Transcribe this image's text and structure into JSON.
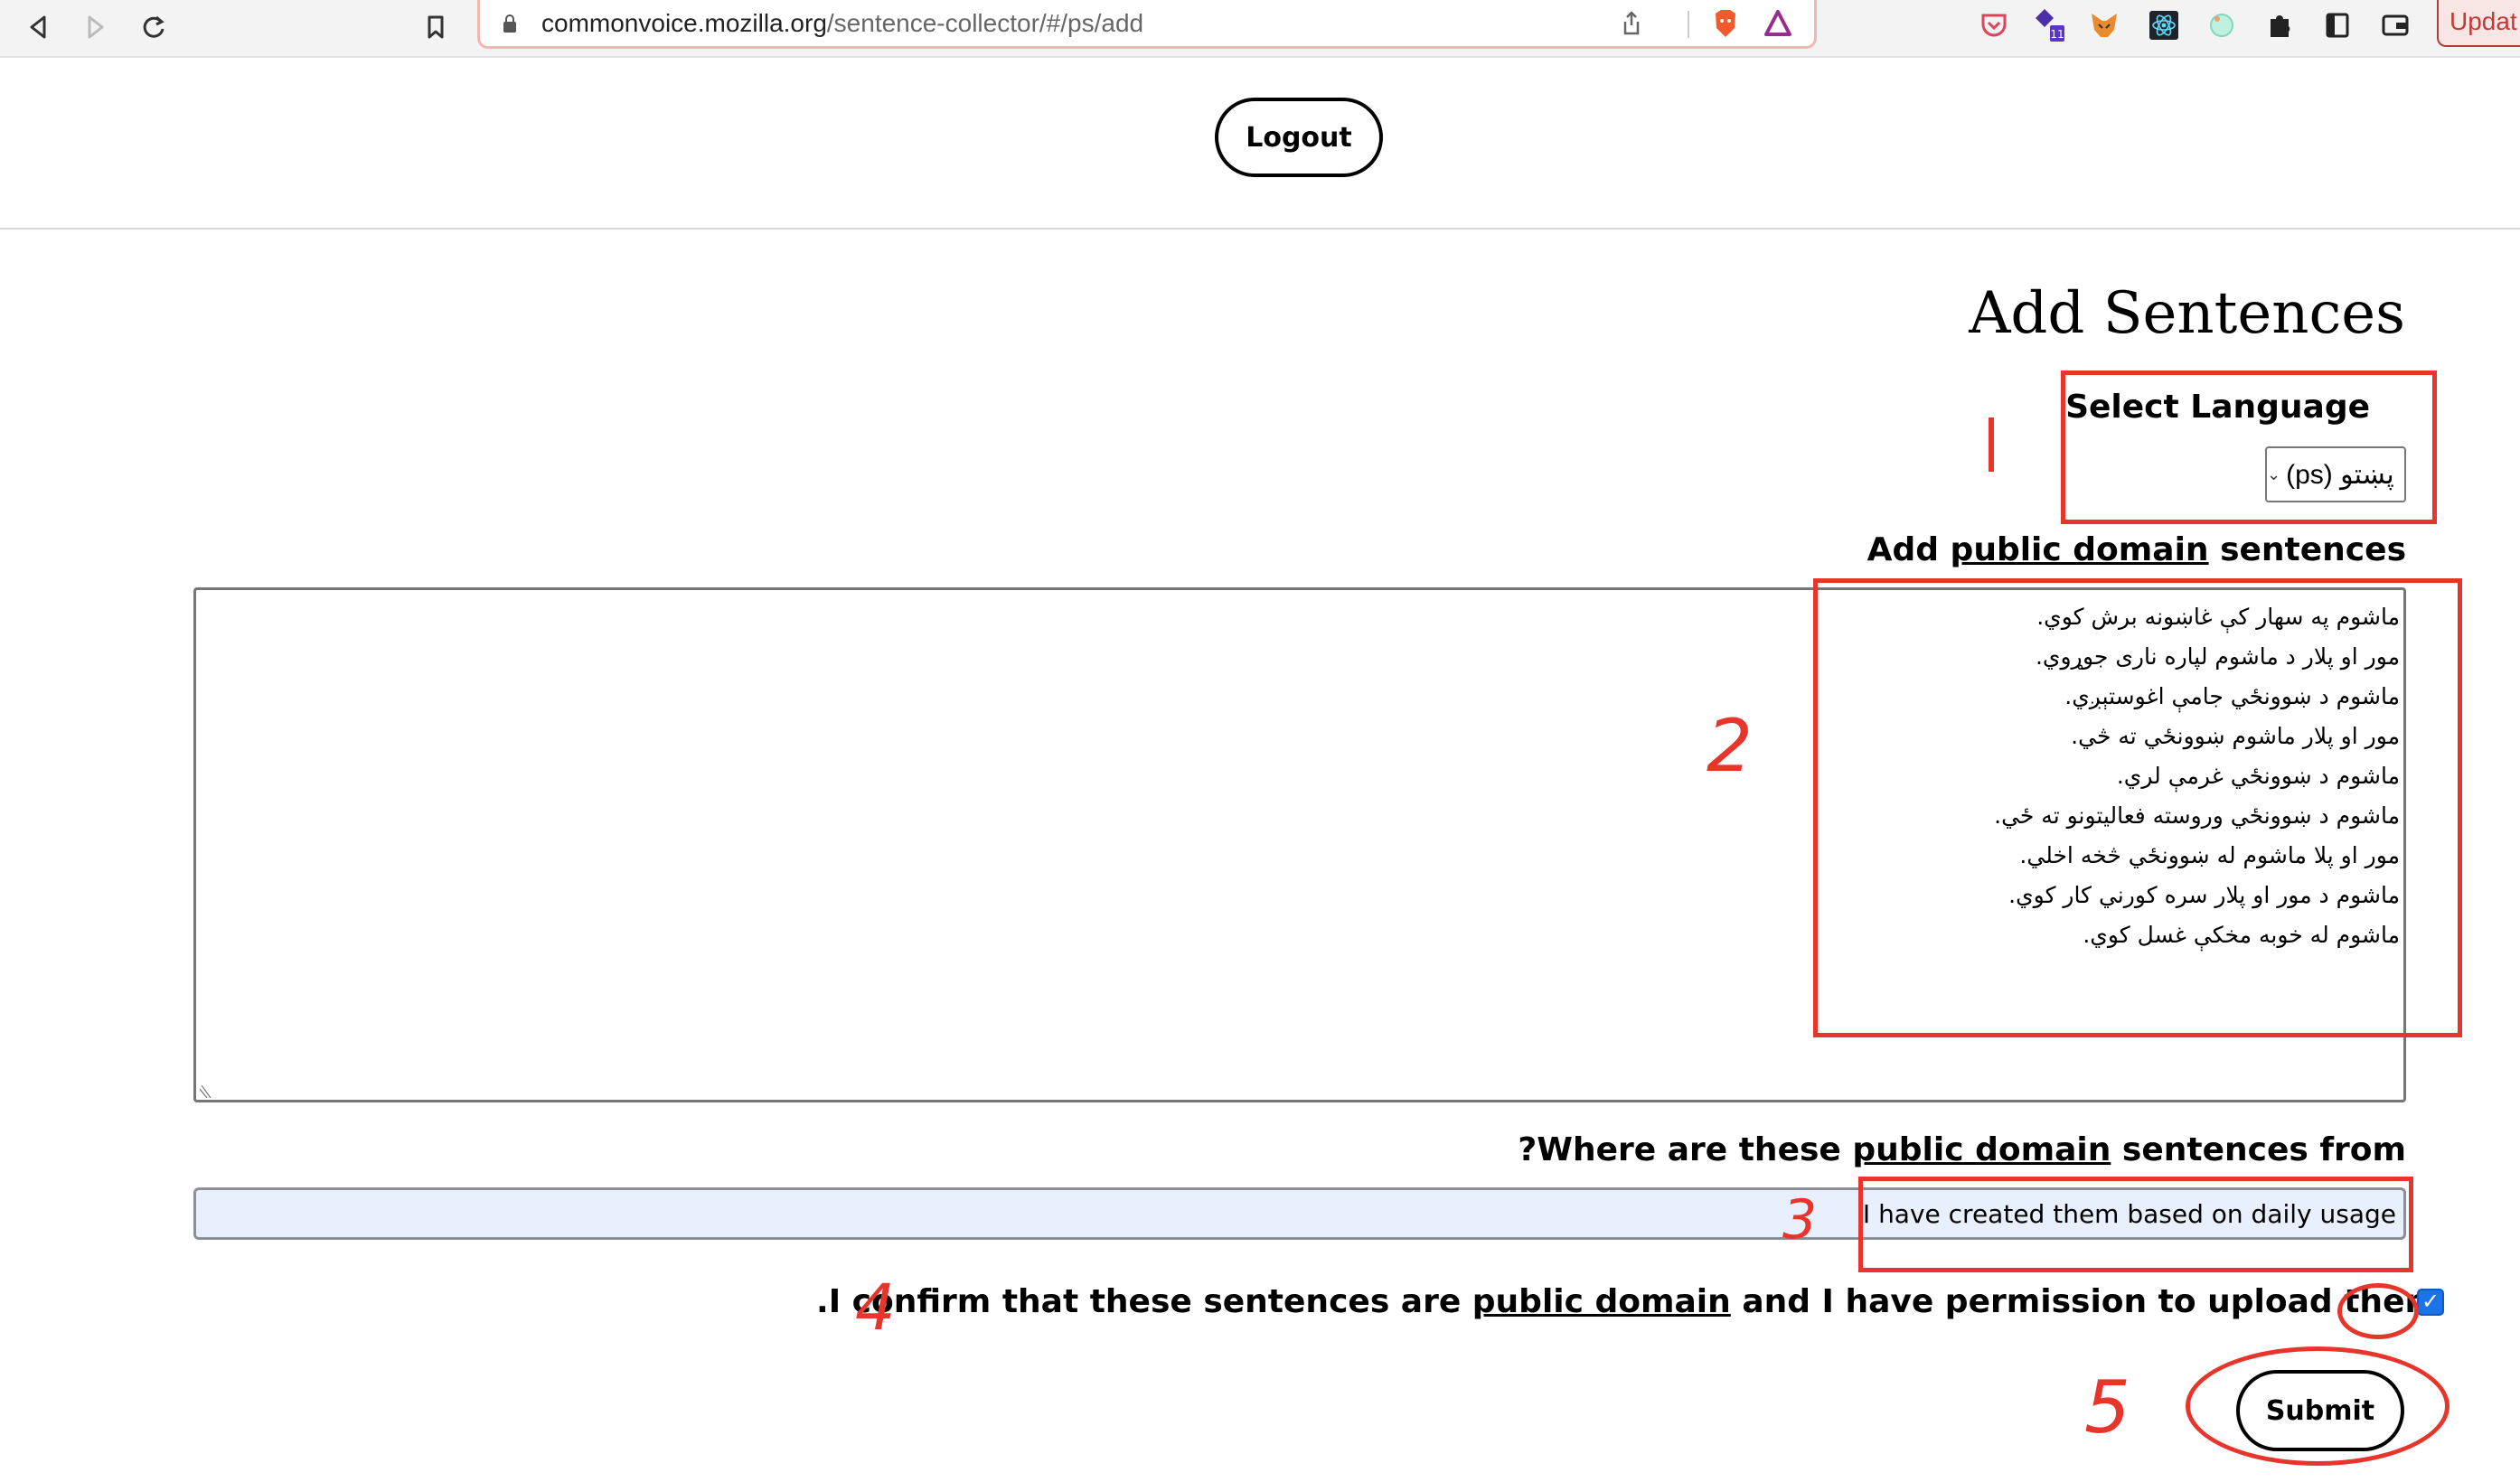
{
  "browser": {
    "url_host": "commonvoice.mozilla.org",
    "url_path": "/sentence-collector/#/ps/add",
    "update_label": "Updat",
    "extension_badge": "11",
    "icons": {
      "back": "back-arrow-icon",
      "forward": "forward-arrow-icon",
      "reload": "reload-icon",
      "bookmark": "bookmark-icon",
      "share": "share-icon",
      "brave": "brave-lion-icon",
      "rewards": "brave-rewards-icon",
      "pocket": "pocket-icon",
      "extensions": [
        "stack-extension-icon",
        "metamask-icon",
        "react-devtools-icon",
        "circle-extension-icon",
        "puzzle-extensions-icon",
        "sidebar-icon",
        "wallet-icon"
      ]
    }
  },
  "header": {
    "logout_label": "Logout"
  },
  "main": {
    "title": "Add Sentences",
    "language": {
      "label": "Select Language",
      "selected": "پښتو (ps)"
    },
    "sentences": {
      "label_prefix": "Add ",
      "label_link": "public domain",
      "label_suffix": " sentences",
      "lines": [
        "ماشوم په سهار کې غاښونه برش کوي.",
        "مور او پلار د ماشوم لپاره ناری جوړوي.",
        "ماشوم د ښوونځي جامې اغوستېږي.",
        "مور او پلار ماشوم ښوونځي ته څي.",
        "ماشوم د ښوونځي غرمې لري.",
        "ماشوم د ښوونځي وروسته فعالیتونو ته ځي.",
        "مور او پلا ماشوم له ښوونځي څخه اخلي.",
        "ماشوم د مور او پلار سره کورني کار کوي.",
        "ماشوم له خوبه مخکې غسل کوي."
      ]
    },
    "source": {
      "label_prefix": "?Where are these ",
      "label_link": "public domain",
      "label_suffix": " sentences from",
      "value": "I have created them based on daily usage"
    },
    "confirm": {
      "text_prefix": ".I confirm that these sentences are ",
      "text_link": "public domain",
      "text_suffix": " and I have permission to upload them",
      "checked": true
    },
    "submit_label": "Submit"
  },
  "annotations": {
    "color": "#e8352b",
    "steps": [
      "1",
      "2",
      "3",
      "4",
      "5"
    ]
  }
}
